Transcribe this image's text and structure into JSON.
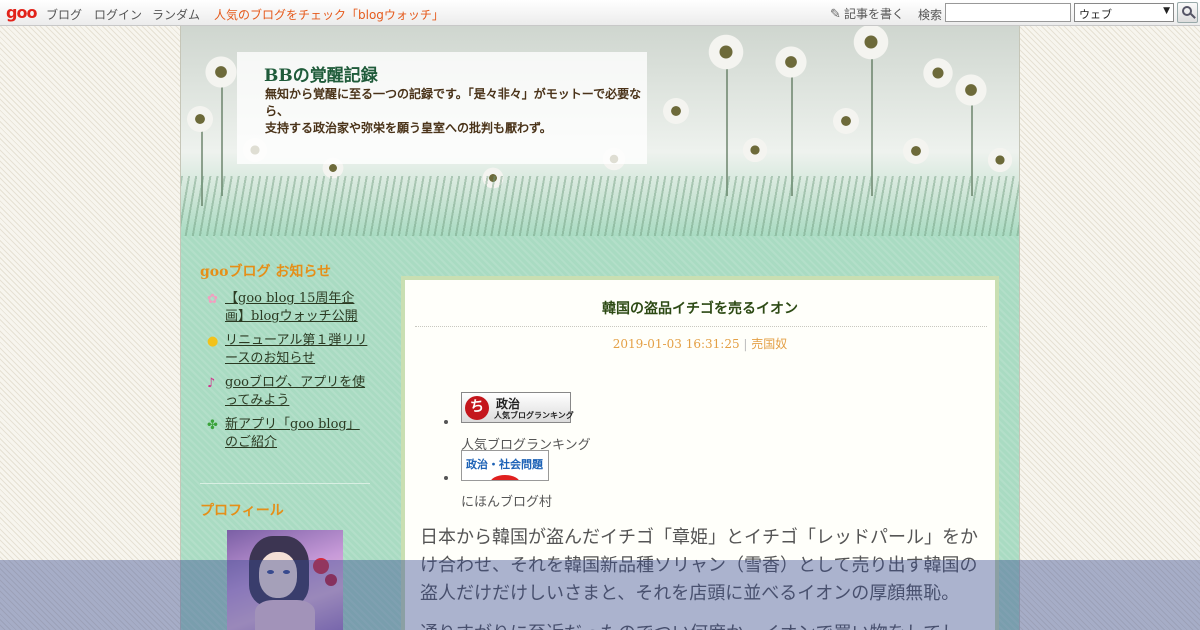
{
  "toolbar": {
    "logo": "goo",
    "links": [
      "ブログ",
      "ログイン",
      "ランダム"
    ],
    "promo": "人気のブログをチェック「blogウォッチ」",
    "write_label": "記事を書く",
    "search_label": "検索",
    "search_value": "",
    "search_scope": "ウェブ"
  },
  "header": {
    "title": "BBの覚醒記録",
    "description_line1": "無知から覚醒に至る一つの記録です。「是々非々」がモットーで必要なら、",
    "description_line2": "支持する政治家や弥栄を願う皇室への批判も厭わず。"
  },
  "sidebar": {
    "news_heading": "gooブログ お知らせ",
    "news_items": [
      {
        "label": "【goo blog 15周年企画】blogウォッチ公開",
        "icon": "flower-icon",
        "color": "#f0a0c0"
      },
      {
        "label": "リニューアル第１弾リリースのお知らせ",
        "icon": "lightbulb-icon",
        "color": "#f2c21a"
      },
      {
        "label": "gooブログ、アプリを使ってみよう",
        "icon": "music-note-icon",
        "color": "#d0308a"
      },
      {
        "label": "新アプリ「goo blog」のご紹介",
        "icon": "clover-icon",
        "color": "#3aa33a"
      }
    ],
    "profile_heading": "プロフィール"
  },
  "article": {
    "title": "韓国の盗品イチゴを売るイオン",
    "date": "2019-01-03 16:31:25",
    "category": "売国奴",
    "banners": [
      {
        "text_main": "政治",
        "text_sub": "人気ブログランキング",
        "caption": "人気ブログランキング"
      },
      {
        "text_main": "政治・社会問題",
        "caption": "にほんブログ村"
      }
    ],
    "body_paragraph1": "日本から韓国が盗んだイチゴ「章姫」とイチゴ「レッドパール」をかけ合わせ、それを韓国新品種ソリャン（雪香）として売り出す韓国の盗人だけだけしいさまと、それを店頭に並べるイオンの厚顔無恥。",
    "body_paragraph2": "通りすがりに至近だったのでつい何度か、イオンで買い物をしてし"
  },
  "colors": {
    "accent_orange": "#e58f18",
    "promo_orange": "#e55a1c",
    "page_green": "#a9dbc2",
    "title_green": "#1f5b3a"
  }
}
